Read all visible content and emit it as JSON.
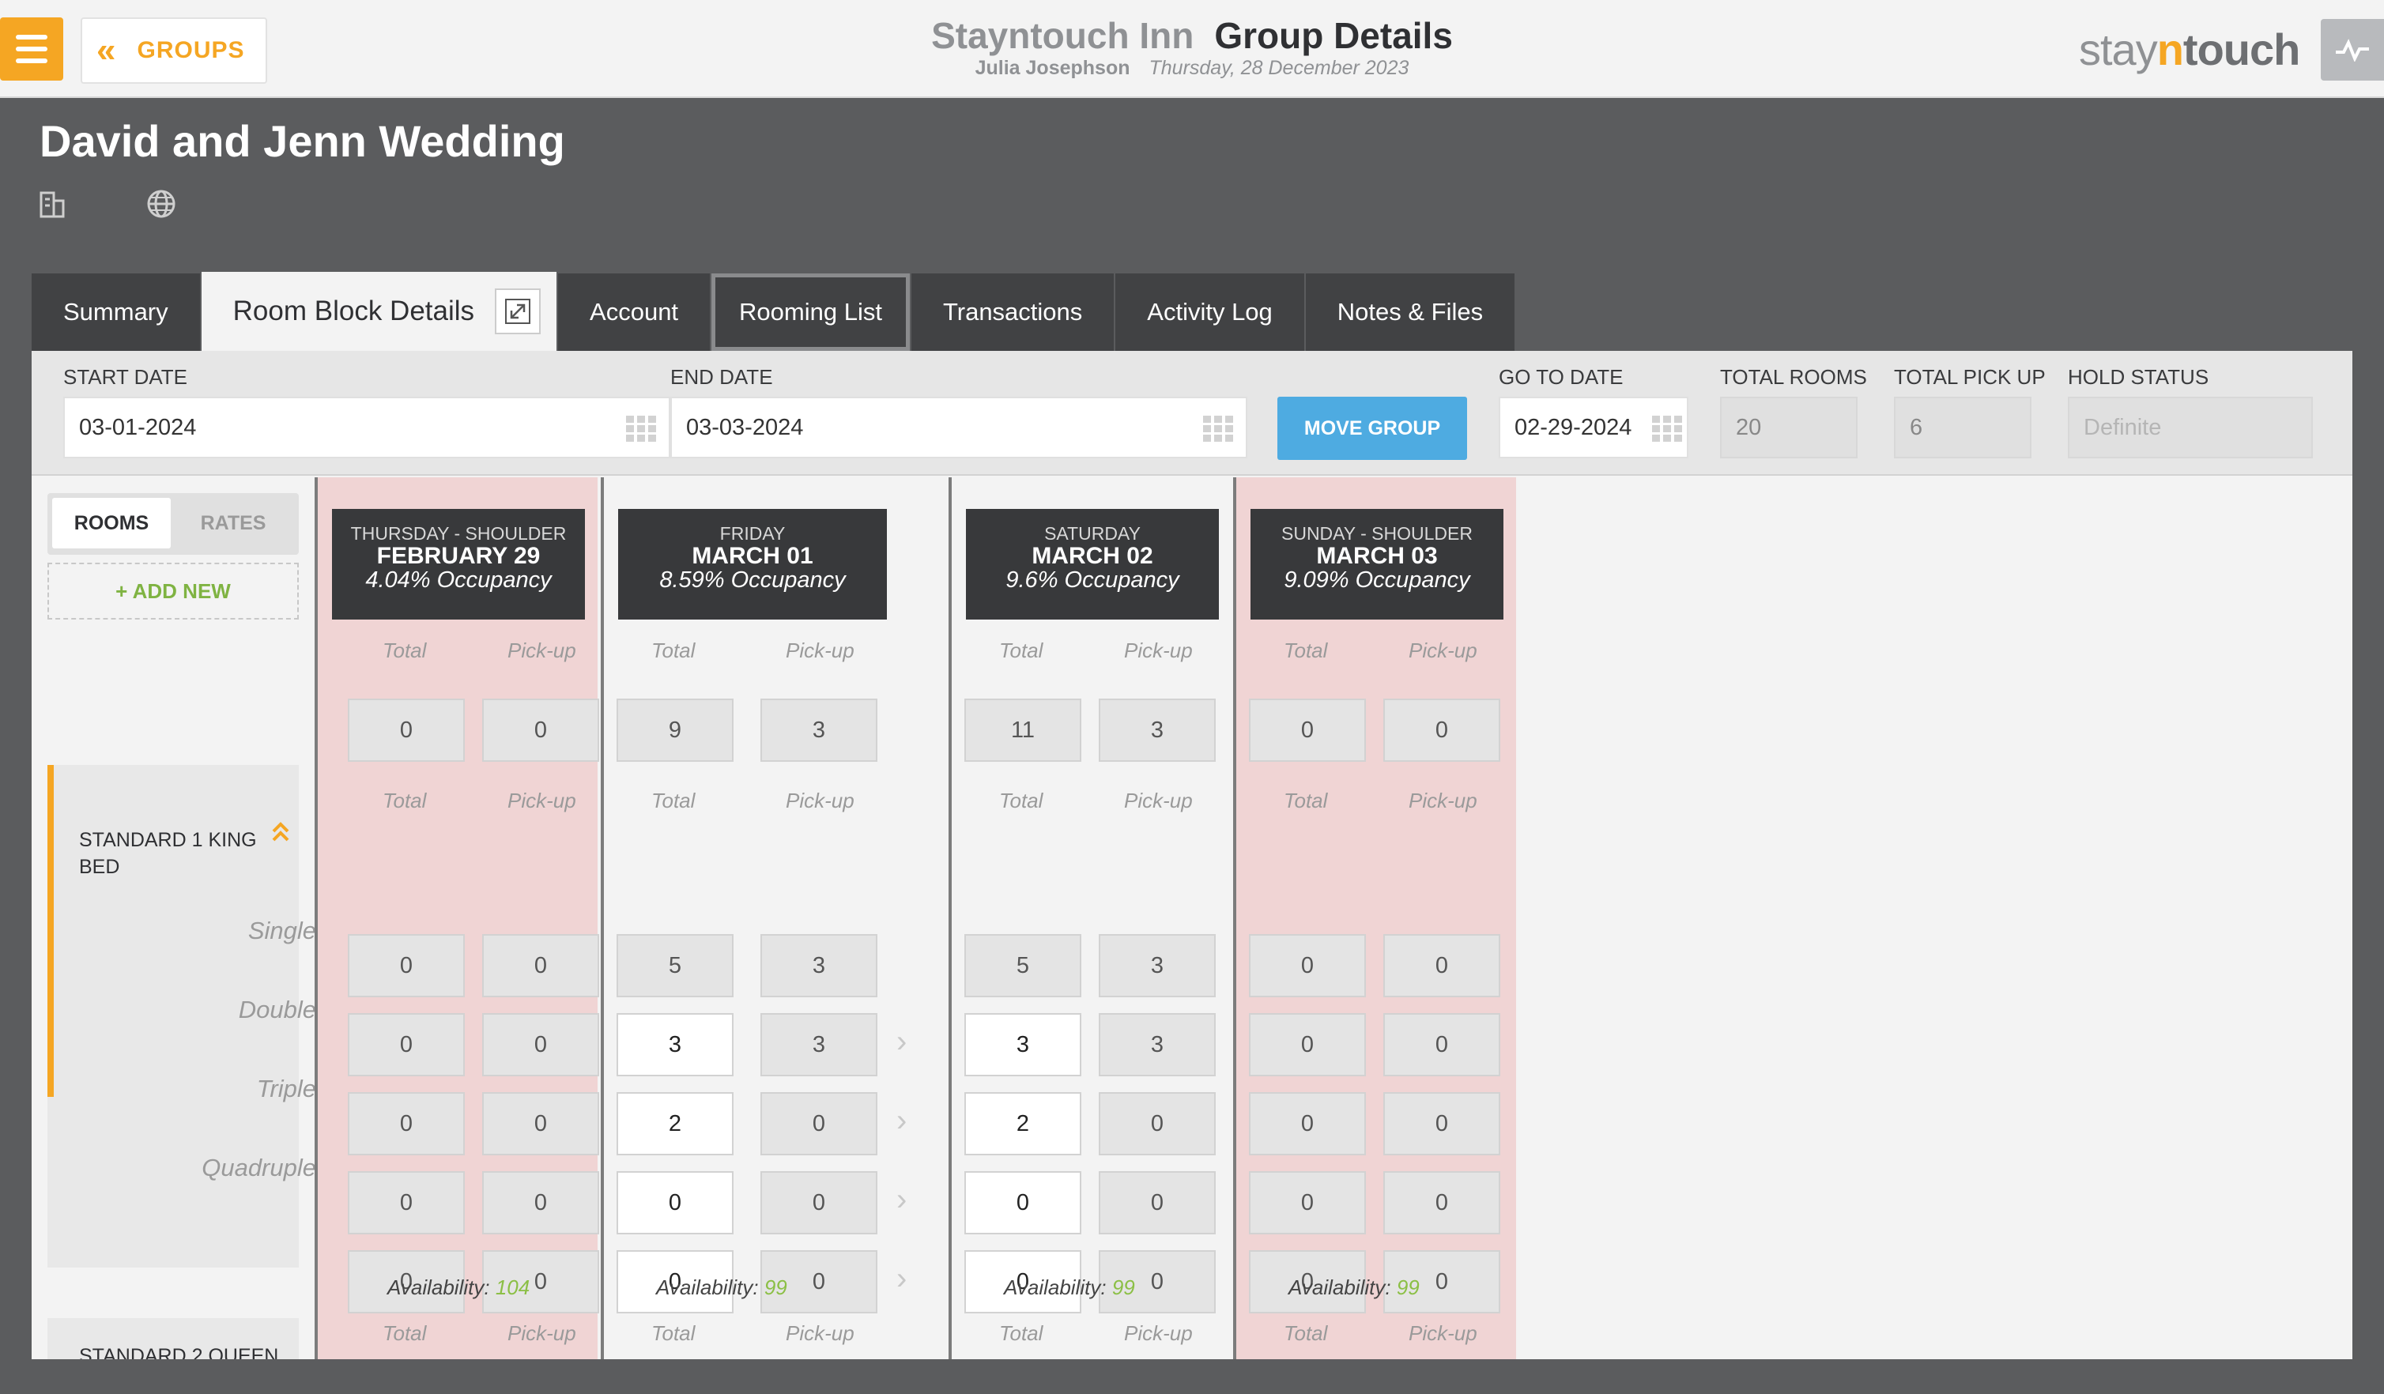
{
  "header": {
    "back_label": "GROUPS",
    "hotel_name": "Stayntouch Inn",
    "page_title": "Group Details",
    "user_name": "Julia Josephson",
    "date": "Thursday, 28 December 2023",
    "logo_stay": "stay",
    "logo_n": "n",
    "logo_touch": "touch"
  },
  "group": {
    "name": "David and Jenn Wedding"
  },
  "tabs": [
    {
      "label": "Summary"
    },
    {
      "label": "Room Block Details"
    },
    {
      "label": "Account"
    },
    {
      "label": "Rooming List"
    },
    {
      "label": "Transactions"
    },
    {
      "label": "Activity Log"
    },
    {
      "label": "Notes & Files"
    }
  ],
  "filters": {
    "start_date_label": "START DATE",
    "start_date": "03-01-2024",
    "end_date_label": "END DATE",
    "end_date": "03-03-2024",
    "move_group_label": "MOVE GROUP",
    "go_to_date_label": "GO TO DATE",
    "go_to_date": "02-29-2024",
    "total_rooms_label": "TOTAL ROOMS",
    "total_rooms": "20",
    "total_pickup_label": "TOTAL PICK UP",
    "total_pickup": "6",
    "hold_status_label": "HOLD STATUS",
    "hold_status": "Definite"
  },
  "toggle": {
    "rooms": "ROOMS",
    "rates": "RATES"
  },
  "add_new_label": "+ ADD NEW",
  "col_labels": {
    "total": "Total",
    "pickup": "Pick-up"
  },
  "days": [
    {
      "dow": "THURSDAY - SHOULDER",
      "date": "FEBRUARY 29",
      "occupancy": "4.04% Occupancy",
      "total": "0",
      "pickup": "0",
      "room_total": "0",
      "room_pickup": "0",
      "single": [
        "0",
        "0"
      ],
      "double": [
        "0",
        "0"
      ],
      "triple": [
        "0",
        "0"
      ],
      "quadruple": [
        "0",
        "0"
      ],
      "availability": "104"
    },
    {
      "dow": "FRIDAY",
      "date": "MARCH 01",
      "occupancy": "8.59% Occupancy",
      "total": "9",
      "pickup": "3",
      "room_total": "5",
      "room_pickup": "3",
      "single": [
        "3",
        "3"
      ],
      "double": [
        "2",
        "0"
      ],
      "triple": [
        "0",
        "0"
      ],
      "quadruple": [
        "0",
        "0"
      ],
      "availability": "99"
    },
    {
      "dow": "SATURDAY",
      "date": "MARCH 02",
      "occupancy": "9.6% Occupancy",
      "total": "11",
      "pickup": "3",
      "room_total": "5",
      "room_pickup": "3",
      "single": [
        "3",
        "3"
      ],
      "double": [
        "2",
        "0"
      ],
      "triple": [
        "0",
        "0"
      ],
      "quadruple": [
        "0",
        "0"
      ],
      "availability": "99"
    },
    {
      "dow": "SUNDAY - SHOULDER",
      "date": "MARCH 03",
      "occupancy": "9.09% Occupancy",
      "total": "0",
      "pickup": "0",
      "room_total": "0",
      "room_pickup": "0",
      "single": [
        "0",
        "0"
      ],
      "double": [
        "0",
        "0"
      ],
      "triple": [
        "0",
        "0"
      ],
      "quadruple": [
        "0",
        "0"
      ],
      "availability": "99"
    }
  ],
  "room_type": {
    "name": "STANDARD 1 KING BED",
    "occupancies": [
      "Single",
      "Double",
      "Triple",
      "Quadruple"
    ]
  },
  "availability_label": "Availability: ",
  "next_room_type": "STANDARD 2 QUEEN",
  "colors": {
    "accent": "#f5a623",
    "blue": "#4eabe1",
    "green": "#8bbf45",
    "shoulder": "#f0d4d4"
  }
}
